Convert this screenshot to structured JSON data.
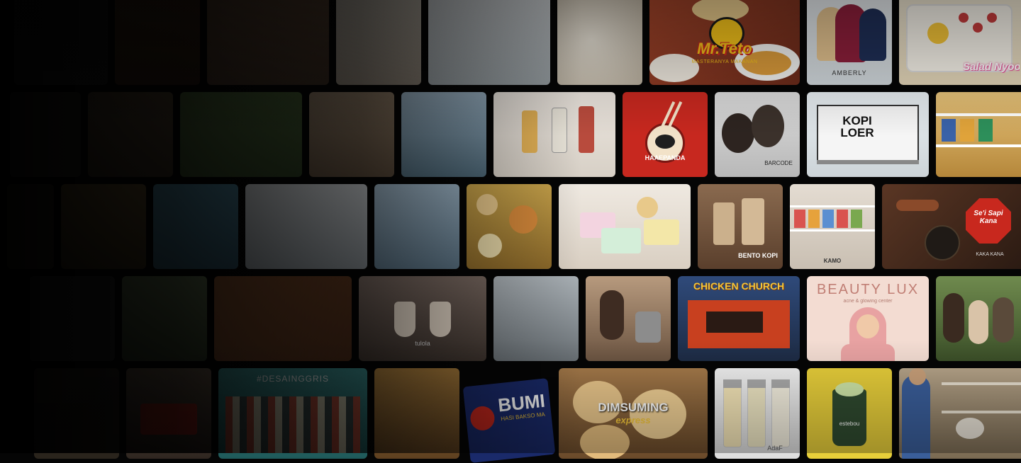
{
  "mosaic": {
    "tiles": {
      "mrteto": {
        "name": "Mr.Teto",
        "tagline": "MASTERANYA MAKANAN"
      },
      "amberly": {
        "name": "AMBERLY"
      },
      "saladnyoo": {
        "name": "Salad Nyoo"
      },
      "haaepanda": {
        "name": "HAAEPANDA"
      },
      "barcode": {
        "name": "BARCODE"
      },
      "kopiloer": {
        "name": "KOPI LOER"
      },
      "bentokopi": {
        "name": "BENTO KOPI"
      },
      "kamo": {
        "name": "KAMO"
      },
      "sesapi": {
        "name": "Se'i Sapi Kana",
        "sub": "KAKA KANA"
      },
      "chickenchurch": {
        "name": "CHICKEN CHURCH"
      },
      "beautylux": {
        "name": "BEAUTY LUX",
        "sub": "acne & glowing center"
      },
      "dimsuming": {
        "name": "DIMSUMING",
        "sub": "express"
      },
      "bumi": {
        "name": "BUMI",
        "sub": "HASI BAKSO MA"
      },
      "adaf": {
        "name": "AdaF"
      },
      "estebou": {
        "name": "estebou"
      },
      "tulola": {
        "name": "tulola"
      },
      "desainggris": {
        "name": "#DESAINGGRIS"
      }
    }
  },
  "colors": {
    "background": "#050505",
    "mrteto_red": "#c8281e",
    "mrteto_yellow": "#f4c21a",
    "beautylux_bg": "#f3dcd2",
    "haaepanda_red": "#c7281f",
    "estebou_yellow": "#e8cf3a"
  }
}
